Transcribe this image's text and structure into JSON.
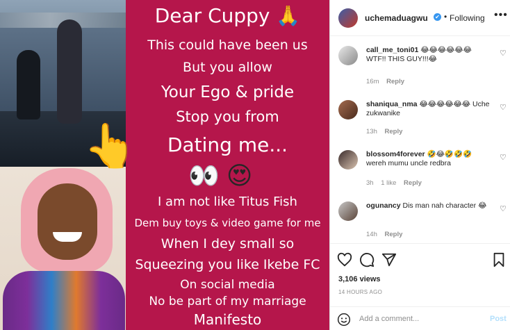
{
  "media": {
    "poster_lines": [
      "Dear Cuppy 🙏",
      "This could have been us",
      "But you allow",
      "Your Ego & pride",
      "Stop you from",
      "Dating me...",
      "I am not like Titus Fish",
      "Dem buy toys & video game for me",
      "When I dey small so",
      "Squeezing you like Ikebe FC",
      "On social media",
      "No be part of my marriage",
      "Manifesto"
    ],
    "emoji_row": "👀 😍",
    "hand_emoji": "👆"
  },
  "header": {
    "username": "uchemaduagwu",
    "verified_glyph": "✔",
    "separator": "•",
    "follow_status": "Following",
    "more_icon": "•••"
  },
  "comments": [
    {
      "username": "call_me_toni01",
      "text": "😂😂😂😂😂😂 WTF!! THIS GUY!!!😂",
      "time": "16m",
      "likes": "",
      "reply": "Reply"
    },
    {
      "username": "shaniqua_nma",
      "text": "😂😂😂😂😂😂 Uche zukwanike",
      "time": "13h",
      "likes": "",
      "reply": "Reply"
    },
    {
      "username": "blossom4forever",
      "text": "🤣😂🤣🤣🤣 wereh mumu uncle redbra",
      "time": "3h",
      "likes": "1 like",
      "reply": "Reply"
    },
    {
      "username": "ogunancy",
      "text": "Dis man nah character 😂",
      "time": "14h",
      "likes": "",
      "reply": "Reply"
    }
  ],
  "stats": {
    "views": "3,106 views",
    "posted_ago": "14 HOURS AGO"
  },
  "add_comment": {
    "placeholder": "Add a comment...",
    "post_label": "Post"
  },
  "colors": {
    "poster_bg": "#b5164b",
    "link_blue": "#3897f0",
    "post_disabled": "#b2dffc"
  },
  "icons": [
    "heart-icon",
    "comment-icon",
    "share-icon",
    "bookmark-icon",
    "smiley-icon",
    "more-icon",
    "verified-badge-icon"
  ]
}
